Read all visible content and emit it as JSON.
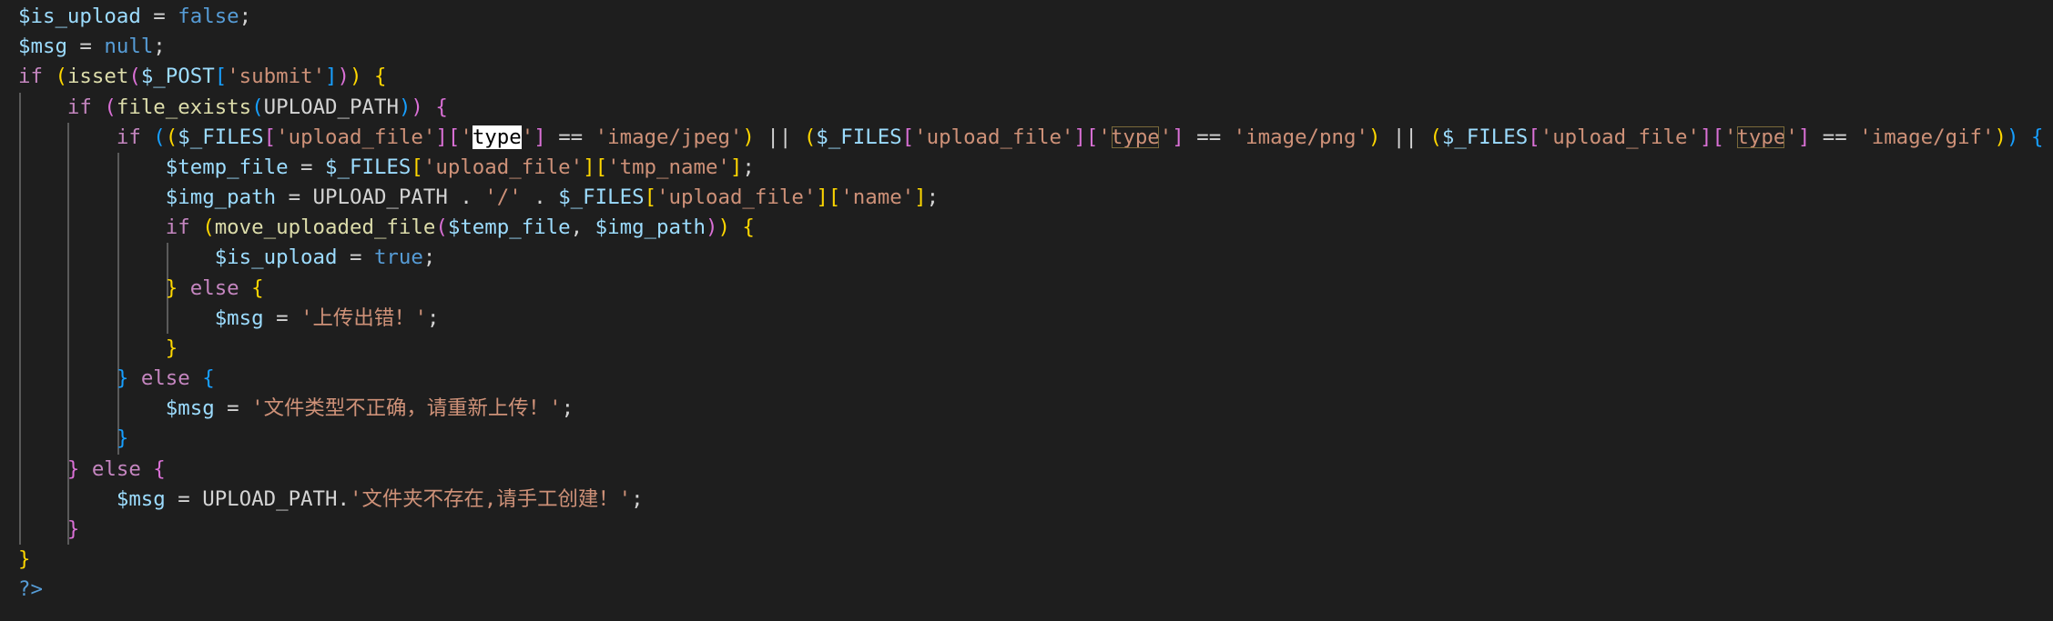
{
  "editor": {
    "language": "php",
    "theme": {
      "background": "#1e1e1e",
      "variable": "#9cdcfe",
      "keyword": "#c586c0",
      "constant": "#569cd6",
      "function": "#dcdcaa",
      "string": "#ce9178",
      "bracket_level1": "#ffd700",
      "bracket_level2": "#da70d6",
      "bracket_level3": "#179fff"
    },
    "highlighted_word": "type",
    "lines": [
      [
        {
          "t": "$is_upload",
          "c": "v"
        },
        {
          "t": " = ",
          "c": "op"
        },
        {
          "t": "false",
          "c": "cn"
        },
        {
          "t": ";",
          "c": "op"
        }
      ],
      [
        {
          "t": "$msg",
          "c": "v"
        },
        {
          "t": " = ",
          "c": "op"
        },
        {
          "t": "null",
          "c": "cn"
        },
        {
          "t": ";",
          "c": "op"
        }
      ],
      [
        {
          "t": "if",
          "c": "kw"
        },
        {
          "t": " ",
          "c": "op"
        },
        {
          "t": "(",
          "c": "b1"
        },
        {
          "t": "isset",
          "c": "fn"
        },
        {
          "t": "(",
          "c": "b2"
        },
        {
          "t": "$_POST",
          "c": "v"
        },
        {
          "t": "[",
          "c": "b3"
        },
        {
          "t": "'submit'",
          "c": "s"
        },
        {
          "t": "]",
          "c": "b3"
        },
        {
          "t": ")",
          "c": "b2"
        },
        {
          "t": ")",
          "c": "b1"
        },
        {
          "t": " ",
          "c": "op"
        },
        {
          "t": "{",
          "c": "b1"
        }
      ],
      [
        {
          "t": "    ",
          "c": "op"
        },
        {
          "t": "if",
          "c": "kw"
        },
        {
          "t": " ",
          "c": "op"
        },
        {
          "t": "(",
          "c": "b2"
        },
        {
          "t": "file_exists",
          "c": "fn"
        },
        {
          "t": "(",
          "c": "b3"
        },
        {
          "t": "UPLOAD_PATH",
          "c": "op"
        },
        {
          "t": ")",
          "c": "b3"
        },
        {
          "t": ")",
          "c": "b2"
        },
        {
          "t": " ",
          "c": "op"
        },
        {
          "t": "{",
          "c": "b2"
        }
      ],
      [
        {
          "t": "        ",
          "c": "op"
        },
        {
          "t": "if",
          "c": "kw"
        },
        {
          "t": " ",
          "c": "op"
        },
        {
          "t": "(",
          "c": "b3"
        },
        {
          "t": "(",
          "c": "b1"
        },
        {
          "t": "$_FILES",
          "c": "v"
        },
        {
          "t": "[",
          "c": "b2"
        },
        {
          "t": "'upload_file'",
          "c": "s"
        },
        {
          "t": "]",
          "c": "b2"
        },
        {
          "t": "[",
          "c": "b2"
        },
        {
          "t": "'",
          "c": "s"
        },
        {
          "t": "type",
          "c": "hl"
        },
        {
          "t": "'",
          "c": "s"
        },
        {
          "t": "]",
          "c": "b2"
        },
        {
          "t": " == ",
          "c": "op"
        },
        {
          "t": "'image/jpeg'",
          "c": "s"
        },
        {
          "t": ")",
          "c": "b1"
        },
        {
          "t": " || ",
          "c": "op"
        },
        {
          "t": "(",
          "c": "b1"
        },
        {
          "t": "$_FILES",
          "c": "v"
        },
        {
          "t": "[",
          "c": "b2"
        },
        {
          "t": "'upload_file'",
          "c": "s"
        },
        {
          "t": "]",
          "c": "b2"
        },
        {
          "t": "[",
          "c": "b2"
        },
        {
          "t": "'",
          "c": "s"
        },
        {
          "t": "type",
          "c": "s hl2"
        },
        {
          "t": "'",
          "c": "s"
        },
        {
          "t": "]",
          "c": "b2"
        },
        {
          "t": " == ",
          "c": "op"
        },
        {
          "t": "'image/png'",
          "c": "s"
        },
        {
          "t": ")",
          "c": "b1"
        },
        {
          "t": " || ",
          "c": "op"
        },
        {
          "t": "(",
          "c": "b1"
        },
        {
          "t": "$_FILES",
          "c": "v"
        },
        {
          "t": "[",
          "c": "b2"
        },
        {
          "t": "'upload_file'",
          "c": "s"
        },
        {
          "t": "]",
          "c": "b2"
        },
        {
          "t": "[",
          "c": "b2"
        },
        {
          "t": "'",
          "c": "s"
        },
        {
          "t": "type",
          "c": "s hl2"
        },
        {
          "t": "'",
          "c": "s"
        },
        {
          "t": "]",
          "c": "b2"
        },
        {
          "t": " == ",
          "c": "op"
        },
        {
          "t": "'image/gif'",
          "c": "s"
        },
        {
          "t": ")",
          "c": "b1"
        },
        {
          "t": ")",
          "c": "b3"
        },
        {
          "t": " ",
          "c": "op"
        },
        {
          "t": "{",
          "c": "b3"
        }
      ],
      [
        {
          "t": "            ",
          "c": "op"
        },
        {
          "t": "$temp_file",
          "c": "v"
        },
        {
          "t": " = ",
          "c": "op"
        },
        {
          "t": "$_FILES",
          "c": "v"
        },
        {
          "t": "[",
          "c": "b1"
        },
        {
          "t": "'upload_file'",
          "c": "s"
        },
        {
          "t": "]",
          "c": "b1"
        },
        {
          "t": "[",
          "c": "b1"
        },
        {
          "t": "'tmp_name'",
          "c": "s"
        },
        {
          "t": "]",
          "c": "b1"
        },
        {
          "t": ";",
          "c": "op"
        }
      ],
      [
        {
          "t": "            ",
          "c": "op"
        },
        {
          "t": "$img_path",
          "c": "v"
        },
        {
          "t": " = ",
          "c": "op"
        },
        {
          "t": "UPLOAD_PATH",
          "c": "op"
        },
        {
          "t": " . ",
          "c": "op"
        },
        {
          "t": "'/'",
          "c": "s"
        },
        {
          "t": " . ",
          "c": "op"
        },
        {
          "t": "$_FILES",
          "c": "v"
        },
        {
          "t": "[",
          "c": "b1"
        },
        {
          "t": "'upload_file'",
          "c": "s"
        },
        {
          "t": "]",
          "c": "b1"
        },
        {
          "t": "[",
          "c": "b1"
        },
        {
          "t": "'name'",
          "c": "s"
        },
        {
          "t": "]",
          "c": "b1"
        },
        {
          "t": ";",
          "c": "op"
        }
      ],
      [
        {
          "t": "            ",
          "c": "op"
        },
        {
          "t": "if",
          "c": "kw"
        },
        {
          "t": " ",
          "c": "op"
        },
        {
          "t": "(",
          "c": "b1"
        },
        {
          "t": "move_uploaded_file",
          "c": "fn"
        },
        {
          "t": "(",
          "c": "b2"
        },
        {
          "t": "$temp_file",
          "c": "v"
        },
        {
          "t": ", ",
          "c": "op"
        },
        {
          "t": "$img_path",
          "c": "v"
        },
        {
          "t": ")",
          "c": "b2"
        },
        {
          "t": ")",
          "c": "b1"
        },
        {
          "t": " ",
          "c": "op"
        },
        {
          "t": "{",
          "c": "b1"
        }
      ],
      [
        {
          "t": "                ",
          "c": "op"
        },
        {
          "t": "$is_upload",
          "c": "v"
        },
        {
          "t": " = ",
          "c": "op"
        },
        {
          "t": "true",
          "c": "cn"
        },
        {
          "t": ";",
          "c": "op"
        }
      ],
      [
        {
          "t": "            ",
          "c": "op"
        },
        {
          "t": "}",
          "c": "b1"
        },
        {
          "t": " ",
          "c": "op"
        },
        {
          "t": "else",
          "c": "kw"
        },
        {
          "t": " ",
          "c": "op"
        },
        {
          "t": "{",
          "c": "b1"
        }
      ],
      [
        {
          "t": "                ",
          "c": "op"
        },
        {
          "t": "$msg",
          "c": "v"
        },
        {
          "t": " = ",
          "c": "op"
        },
        {
          "t": "'上传出错！'",
          "c": "s"
        },
        {
          "t": ";",
          "c": "op"
        }
      ],
      [
        {
          "t": "            ",
          "c": "op"
        },
        {
          "t": "}",
          "c": "b1"
        }
      ],
      [
        {
          "t": "        ",
          "c": "op"
        },
        {
          "t": "}",
          "c": "b3"
        },
        {
          "t": " ",
          "c": "op"
        },
        {
          "t": "else",
          "c": "kw"
        },
        {
          "t": " ",
          "c": "op"
        },
        {
          "t": "{",
          "c": "b3"
        }
      ],
      [
        {
          "t": "            ",
          "c": "op"
        },
        {
          "t": "$msg",
          "c": "v"
        },
        {
          "t": " = ",
          "c": "op"
        },
        {
          "t": "'文件类型不正确，请重新上传！'",
          "c": "s"
        },
        {
          "t": ";",
          "c": "op"
        }
      ],
      [
        {
          "t": "        ",
          "c": "op"
        },
        {
          "t": "}",
          "c": "b3"
        }
      ],
      [
        {
          "t": "    ",
          "c": "op"
        },
        {
          "t": "}",
          "c": "b2"
        },
        {
          "t": " ",
          "c": "op"
        },
        {
          "t": "else",
          "c": "kw"
        },
        {
          "t": " ",
          "c": "op"
        },
        {
          "t": "{",
          "c": "b2"
        }
      ],
      [
        {
          "t": "        ",
          "c": "op"
        },
        {
          "t": "$msg",
          "c": "v"
        },
        {
          "t": " = ",
          "c": "op"
        },
        {
          "t": "UPLOAD_PATH",
          "c": "op"
        },
        {
          "t": ".",
          "c": "op"
        },
        {
          "t": "'文件夹不存在,请手工创建！'",
          "c": "s"
        },
        {
          "t": ";",
          "c": "op"
        }
      ],
      [
        {
          "t": "    ",
          "c": "op"
        },
        {
          "t": "}",
          "c": "b2"
        }
      ],
      [
        {
          "t": "}",
          "c": "b1"
        }
      ],
      [
        {
          "t": "?>",
          "c": "cn"
        }
      ]
    ]
  }
}
